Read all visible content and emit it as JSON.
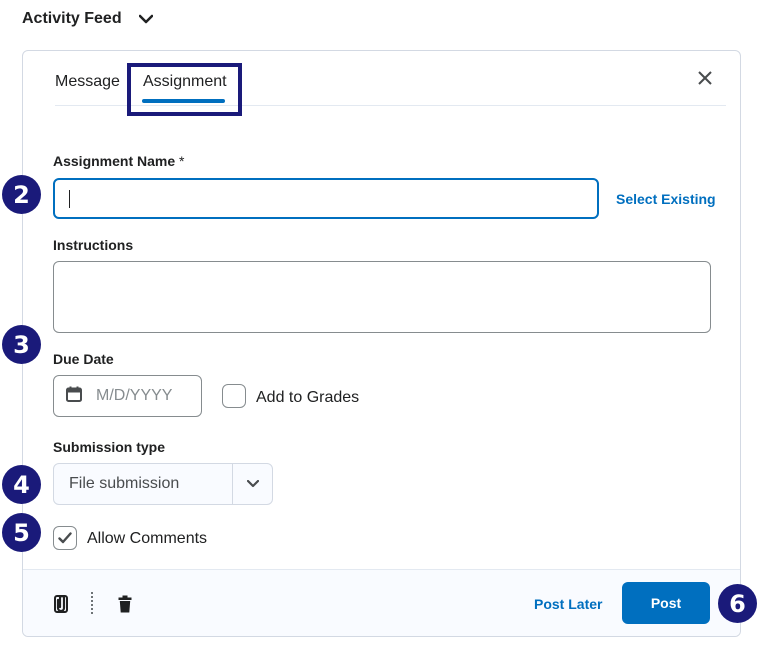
{
  "feed": {
    "title": "Activity Feed",
    "toggle_icon": "chevron-down-icon"
  },
  "tabs": [
    {
      "label": "Message",
      "active": false
    },
    {
      "label": "Assignment",
      "active": true
    }
  ],
  "close_icon": "close-icon",
  "form": {
    "name_label": "Assignment Name",
    "required_mark": "*",
    "name_value": "",
    "select_existing": "Select Existing",
    "instructions_label": "Instructions",
    "instructions_value": "",
    "due_date_label": "Due Date",
    "due_date_placeholder": "M/D/YYYY",
    "add_to_grades": {
      "label": "Add to Grades",
      "checked": false
    },
    "submission_type_label": "Submission type",
    "submission_type_value": "File submission",
    "allow_comments": {
      "label": "Allow Comments",
      "checked": true
    }
  },
  "footer": {
    "attach_icon": "paperclip-icon",
    "delete_icon": "trash-icon",
    "post_later": "Post Later",
    "post": "Post"
  },
  "callouts": [
    "2",
    "3",
    "4",
    "5",
    "6"
  ],
  "colors": {
    "accent": "#006fbf",
    "callout": "#1a1a7a",
    "border": "#868c8f"
  }
}
